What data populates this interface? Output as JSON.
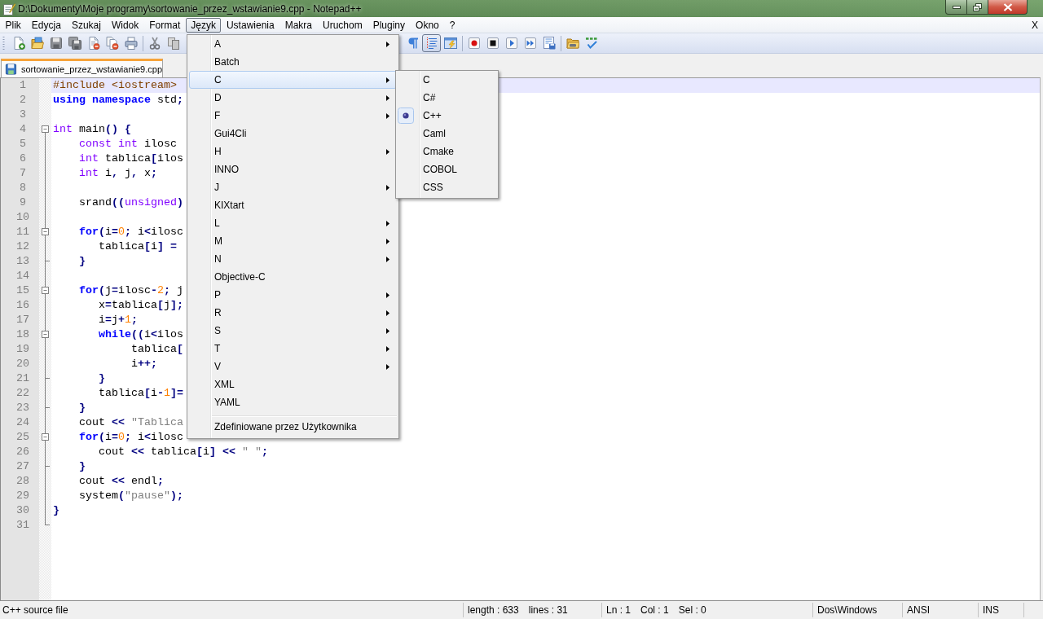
{
  "window": {
    "title": "D:\\Dokumenty\\Moje programy\\sortowanie_przez_wstawianie9.cpp - Notepad++"
  },
  "menu_bar": {
    "items": [
      {
        "label": "Plik",
        "selected": false
      },
      {
        "label": "Edycja",
        "selected": false
      },
      {
        "label": "Szukaj",
        "selected": false
      },
      {
        "label": "Widok",
        "selected": false
      },
      {
        "label": "Format",
        "selected": false
      },
      {
        "label": "Język",
        "selected": true,
        "menu": {
          "sections": [
            {
              "items": [
                {
                  "label": "A",
                  "submenu": true,
                  "selected": false
                },
                {
                  "label": "Batch",
                  "submenu": false,
                  "selected": false
                },
                {
                  "label": "C",
                  "submenu": true,
                  "selected": true,
                  "children": [
                    {
                      "label": "C",
                      "checked": false
                    },
                    {
                      "label": "C#",
                      "checked": false
                    },
                    {
                      "label": "C++",
                      "checked": true
                    },
                    {
                      "label": "Caml",
                      "checked": false
                    },
                    {
                      "label": "Cmake",
                      "checked": false
                    },
                    {
                      "label": "COBOL",
                      "checked": false
                    },
                    {
                      "label": "CSS",
                      "checked": false
                    }
                  ]
                },
                {
                  "label": "D",
                  "submenu": true,
                  "selected": false
                },
                {
                  "label": "F",
                  "submenu": true,
                  "selected": false
                },
                {
                  "label": "Gui4Cli",
                  "submenu": false,
                  "selected": false
                },
                {
                  "label": "H",
                  "submenu": true,
                  "selected": false
                },
                {
                  "label": "INNO",
                  "submenu": false,
                  "selected": false
                },
                {
                  "label": "J",
                  "submenu": true,
                  "selected": false
                },
                {
                  "label": "KIXtart",
                  "submenu": false,
                  "selected": false
                },
                {
                  "label": "L",
                  "submenu": true,
                  "selected": false
                },
                {
                  "label": "M",
                  "submenu": true,
                  "selected": false
                },
                {
                  "label": "N",
                  "submenu": true,
                  "selected": false
                },
                {
                  "label": "Objective-C",
                  "submenu": false,
                  "selected": false
                },
                {
                  "label": "P",
                  "submenu": true,
                  "selected": false
                },
                {
                  "label": "R",
                  "submenu": true,
                  "selected": false
                },
                {
                  "label": "S",
                  "submenu": true,
                  "selected": false
                },
                {
                  "label": "T",
                  "submenu": true,
                  "selected": false
                },
                {
                  "label": "V",
                  "submenu": true,
                  "selected": false
                },
                {
                  "label": "XML",
                  "submenu": false,
                  "selected": false
                },
                {
                  "label": "YAML",
                  "submenu": false,
                  "selected": false
                }
              ]
            },
            {
              "items": [
                {
                  "label": "Zdefiniowane przez Użytkownika",
                  "submenu": false,
                  "selected": false
                }
              ]
            }
          ]
        }
      },
      {
        "label": "Ustawienia",
        "selected": false
      },
      {
        "label": "Makra",
        "selected": false
      },
      {
        "label": "Uruchom",
        "selected": false
      },
      {
        "label": "Pluginy",
        "selected": false
      },
      {
        "label": "Okno",
        "selected": false
      },
      {
        "label": "?",
        "selected": false
      }
    ],
    "close_label": "X"
  },
  "toolbar": {
    "groups": [
      {
        "buttons": [
          {
            "kind": "new"
          },
          {
            "kind": "open"
          },
          {
            "kind": "save"
          },
          {
            "kind": "saveall"
          },
          {
            "kind": "close"
          },
          {
            "kind": "closeall"
          },
          {
            "kind": "print"
          }
        ]
      },
      {
        "buttons": [
          {
            "kind": "cut"
          },
          {
            "kind": "copy"
          }
        ]
      },
      {
        "buttons": [
          {
            "kind": "pilcrow",
            "pressed": false
          },
          {
            "kind": "indent",
            "pressed": true
          },
          {
            "kind": "window",
            "pressed": false
          }
        ]
      },
      {
        "buttons": [
          {
            "kind": "record"
          },
          {
            "kind": "stop"
          },
          {
            "kind": "play"
          },
          {
            "kind": "fastforward"
          },
          {
            "kind": "macrosave"
          }
        ]
      },
      {
        "buttons": [
          {
            "kind": "folder"
          },
          {
            "kind": "spellcheck"
          }
        ]
      }
    ]
  },
  "tabs": [
    {
      "label": "sortowanie_przez_wstawianie9.cpp",
      "selected": true
    }
  ],
  "editor": {
    "lines": [
      {
        "number": "1",
        "current": true,
        "fold_start": false,
        "fold_end": false,
        "tokens": [
          {
            "kind": "preprocessor",
            "text": "#include <iostream>"
          }
        ]
      },
      {
        "number": "2",
        "current": false,
        "fold_start": false,
        "fold_end": false,
        "tokens": [
          {
            "kind": "keyword",
            "text": "using namespace"
          },
          {
            "kind": "text",
            "text": " std"
          },
          {
            "kind": "operator",
            "text": ";"
          }
        ]
      },
      {
        "number": "3",
        "current": false,
        "fold_start": false,
        "fold_end": false
      },
      {
        "number": "4",
        "current": false,
        "fold_start": true,
        "fold_end": false,
        "tokens": [
          {
            "kind": "type",
            "text": "int"
          },
          {
            "kind": "text",
            "text": " main"
          },
          {
            "kind": "operator",
            "text": "() {"
          }
        ]
      },
      {
        "number": "5",
        "current": false,
        "fold_start": false,
        "fold_end": false,
        "tokens": [
          {
            "kind": "type",
            "text": "    const int"
          },
          {
            "kind": "text",
            "text": " ilosc"
          }
        ]
      },
      {
        "number": "6",
        "current": false,
        "fold_start": false,
        "fold_end": false,
        "tokens": [
          {
            "kind": "type",
            "text": "    int"
          },
          {
            "kind": "text",
            "text": " tablica"
          },
          {
            "kind": "operator",
            "text": "["
          },
          {
            "kind": "text",
            "text": "ilos"
          }
        ]
      },
      {
        "number": "7",
        "current": false,
        "fold_start": false,
        "fold_end": false,
        "tokens": [
          {
            "kind": "type",
            "text": "    int"
          },
          {
            "kind": "text",
            "text": " i"
          },
          {
            "kind": "operator",
            "text": ","
          },
          {
            "kind": "text",
            "text": " j"
          },
          {
            "kind": "operator",
            "text": ","
          },
          {
            "kind": "text",
            "text": " x"
          },
          {
            "kind": "operator",
            "text": ";"
          }
        ]
      },
      {
        "number": "8",
        "current": false,
        "fold_start": false,
        "fold_end": false
      },
      {
        "number": "9",
        "current": false,
        "fold_start": false,
        "fold_end": false,
        "tokens": [
          {
            "kind": "text",
            "text": "    srand"
          },
          {
            "kind": "operator",
            "text": "(("
          },
          {
            "kind": "type",
            "text": "unsigned"
          },
          {
            "kind": "operator",
            "text": ")"
          }
        ]
      },
      {
        "number": "10",
        "current": false,
        "fold_start": false,
        "fold_end": false
      },
      {
        "number": "11",
        "current": false,
        "fold_start": true,
        "fold_end": false,
        "tokens": [
          {
            "kind": "keyword",
            "text": "    for"
          },
          {
            "kind": "operator",
            "text": "("
          },
          {
            "kind": "text",
            "text": "i"
          },
          {
            "kind": "operator",
            "text": "="
          },
          {
            "kind": "number",
            "text": "0"
          },
          {
            "kind": "operator",
            "text": ";"
          },
          {
            "kind": "text",
            "text": " i"
          },
          {
            "kind": "operator",
            "text": "<"
          },
          {
            "kind": "text",
            "text": "ilosc"
          }
        ]
      },
      {
        "number": "12",
        "current": false,
        "fold_start": false,
        "fold_end": false,
        "tokens": [
          {
            "kind": "text",
            "text": "       tablica"
          },
          {
            "kind": "operator",
            "text": "["
          },
          {
            "kind": "text",
            "text": "i"
          },
          {
            "kind": "operator",
            "text": "] ="
          }
        ]
      },
      {
        "number": "13",
        "current": false,
        "fold_start": false,
        "fold_end": true,
        "tokens": [
          {
            "kind": "operator",
            "text": "    }"
          }
        ]
      },
      {
        "number": "14",
        "current": false,
        "fold_start": false,
        "fold_end": false
      },
      {
        "number": "15",
        "current": false,
        "fold_start": true,
        "fold_end": false,
        "tokens": [
          {
            "kind": "keyword",
            "text": "    for"
          },
          {
            "kind": "operator",
            "text": "("
          },
          {
            "kind": "text",
            "text": "j"
          },
          {
            "kind": "operator",
            "text": "="
          },
          {
            "kind": "text",
            "text": "ilosc"
          },
          {
            "kind": "operator",
            "text": "-"
          },
          {
            "kind": "number",
            "text": "2"
          },
          {
            "kind": "operator",
            "text": ";"
          },
          {
            "kind": "text",
            "text": " j"
          }
        ]
      },
      {
        "number": "16",
        "current": false,
        "fold_start": false,
        "fold_end": false,
        "tokens": [
          {
            "kind": "text",
            "text": "       x"
          },
          {
            "kind": "operator",
            "text": "="
          },
          {
            "kind": "text",
            "text": "tablica"
          },
          {
            "kind": "operator",
            "text": "["
          },
          {
            "kind": "text",
            "text": "j"
          },
          {
            "kind": "operator",
            "text": "];"
          }
        ]
      },
      {
        "number": "17",
        "current": false,
        "fold_start": false,
        "fold_end": false,
        "tokens": [
          {
            "kind": "text",
            "text": "       i"
          },
          {
            "kind": "operator",
            "text": "="
          },
          {
            "kind": "text",
            "text": "j"
          },
          {
            "kind": "operator",
            "text": "+"
          },
          {
            "kind": "number",
            "text": "1"
          },
          {
            "kind": "operator",
            "text": ";"
          }
        ]
      },
      {
        "number": "18",
        "current": false,
        "fold_start": true,
        "fold_end": false,
        "tokens": [
          {
            "kind": "keyword",
            "text": "       while"
          },
          {
            "kind": "operator",
            "text": "(("
          },
          {
            "kind": "text",
            "text": "i"
          },
          {
            "kind": "operator",
            "text": "<"
          },
          {
            "kind": "text",
            "text": "ilos"
          }
        ]
      },
      {
        "number": "19",
        "current": false,
        "fold_start": false,
        "fold_end": false,
        "tokens": [
          {
            "kind": "text",
            "text": "            tablica"
          },
          {
            "kind": "operator",
            "text": "["
          }
        ]
      },
      {
        "number": "20",
        "current": false,
        "fold_start": false,
        "fold_end": false,
        "tokens": [
          {
            "kind": "text",
            "text": "            i"
          },
          {
            "kind": "operator",
            "text": "++;"
          }
        ]
      },
      {
        "number": "21",
        "current": false,
        "fold_start": false,
        "fold_end": true,
        "tokens": [
          {
            "kind": "operator",
            "text": "       }"
          }
        ]
      },
      {
        "number": "22",
        "current": false,
        "fold_start": false,
        "fold_end": false,
        "tokens": [
          {
            "kind": "text",
            "text": "       tablica"
          },
          {
            "kind": "operator",
            "text": "["
          },
          {
            "kind": "text",
            "text": "i"
          },
          {
            "kind": "operator",
            "text": "-"
          },
          {
            "kind": "number",
            "text": "1"
          },
          {
            "kind": "operator",
            "text": "]="
          }
        ]
      },
      {
        "number": "23",
        "current": false,
        "fold_start": false,
        "fold_end": true,
        "tokens": [
          {
            "kind": "operator",
            "text": "    }"
          }
        ]
      },
      {
        "number": "24",
        "current": false,
        "fold_start": false,
        "fold_end": false,
        "tokens": [
          {
            "kind": "text",
            "text": "    cout "
          },
          {
            "kind": "operator",
            "text": "<<"
          },
          {
            "kind": "string",
            "text": " \"Tablica"
          }
        ]
      },
      {
        "number": "25",
        "current": false,
        "fold_start": true,
        "fold_end": false,
        "tokens": [
          {
            "kind": "keyword",
            "text": "    for"
          },
          {
            "kind": "operator",
            "text": "("
          },
          {
            "kind": "text",
            "text": "i"
          },
          {
            "kind": "operator",
            "text": "="
          },
          {
            "kind": "number",
            "text": "0"
          },
          {
            "kind": "operator",
            "text": ";"
          },
          {
            "kind": "text",
            "text": " i"
          },
          {
            "kind": "operator",
            "text": "<"
          },
          {
            "kind": "text",
            "text": "ilosc"
          }
        ]
      },
      {
        "number": "26",
        "current": false,
        "fold_start": false,
        "fold_end": false,
        "tokens": [
          {
            "kind": "text",
            "text": "       cout "
          },
          {
            "kind": "operator",
            "text": "<<"
          },
          {
            "kind": "text",
            "text": " tablica"
          },
          {
            "kind": "operator",
            "text": "["
          },
          {
            "kind": "text",
            "text": "i"
          },
          {
            "kind": "operator",
            "text": "] <<"
          },
          {
            "kind": "string",
            "text": " \" \""
          },
          {
            "kind": "operator",
            "text": ";"
          }
        ]
      },
      {
        "number": "27",
        "current": false,
        "fold_start": false,
        "fold_end": true,
        "tokens": [
          {
            "kind": "operator",
            "text": "    }"
          }
        ]
      },
      {
        "number": "28",
        "current": false,
        "fold_start": false,
        "fold_end": false,
        "tokens": [
          {
            "kind": "text",
            "text": "    cout "
          },
          {
            "kind": "operator",
            "text": "<<"
          },
          {
            "kind": "text",
            "text": " endl"
          },
          {
            "kind": "operator",
            "text": ";"
          }
        ]
      },
      {
        "number": "29",
        "current": false,
        "fold_start": false,
        "fold_end": false,
        "tokens": [
          {
            "kind": "text",
            "text": "    system"
          },
          {
            "kind": "operator",
            "text": "("
          },
          {
            "kind": "string",
            "text": "\"pause\""
          },
          {
            "kind": "operator",
            "text": ");"
          }
        ]
      },
      {
        "number": "30",
        "current": false,
        "fold_start": false,
        "fold_end": false,
        "tokens": [
          {
            "kind": "operator",
            "text": "}"
          }
        ]
      },
      {
        "number": "31",
        "current": false,
        "fold_start": false,
        "fold_end": true
      }
    ]
  },
  "status_bar": {
    "sections": [
      {
        "texts": [
          "C++ source file"
        ]
      },
      {
        "texts": [
          "length : 633",
          "lines : 31"
        ]
      },
      {
        "texts": [
          "Ln : 1",
          "Col : 1",
          "Sel : 0"
        ]
      },
      {
        "texts": [
          "Dos\\Windows"
        ]
      },
      {
        "texts": [
          "ANSI"
        ]
      },
      {
        "texts": [
          "INS"
        ]
      }
    ]
  }
}
